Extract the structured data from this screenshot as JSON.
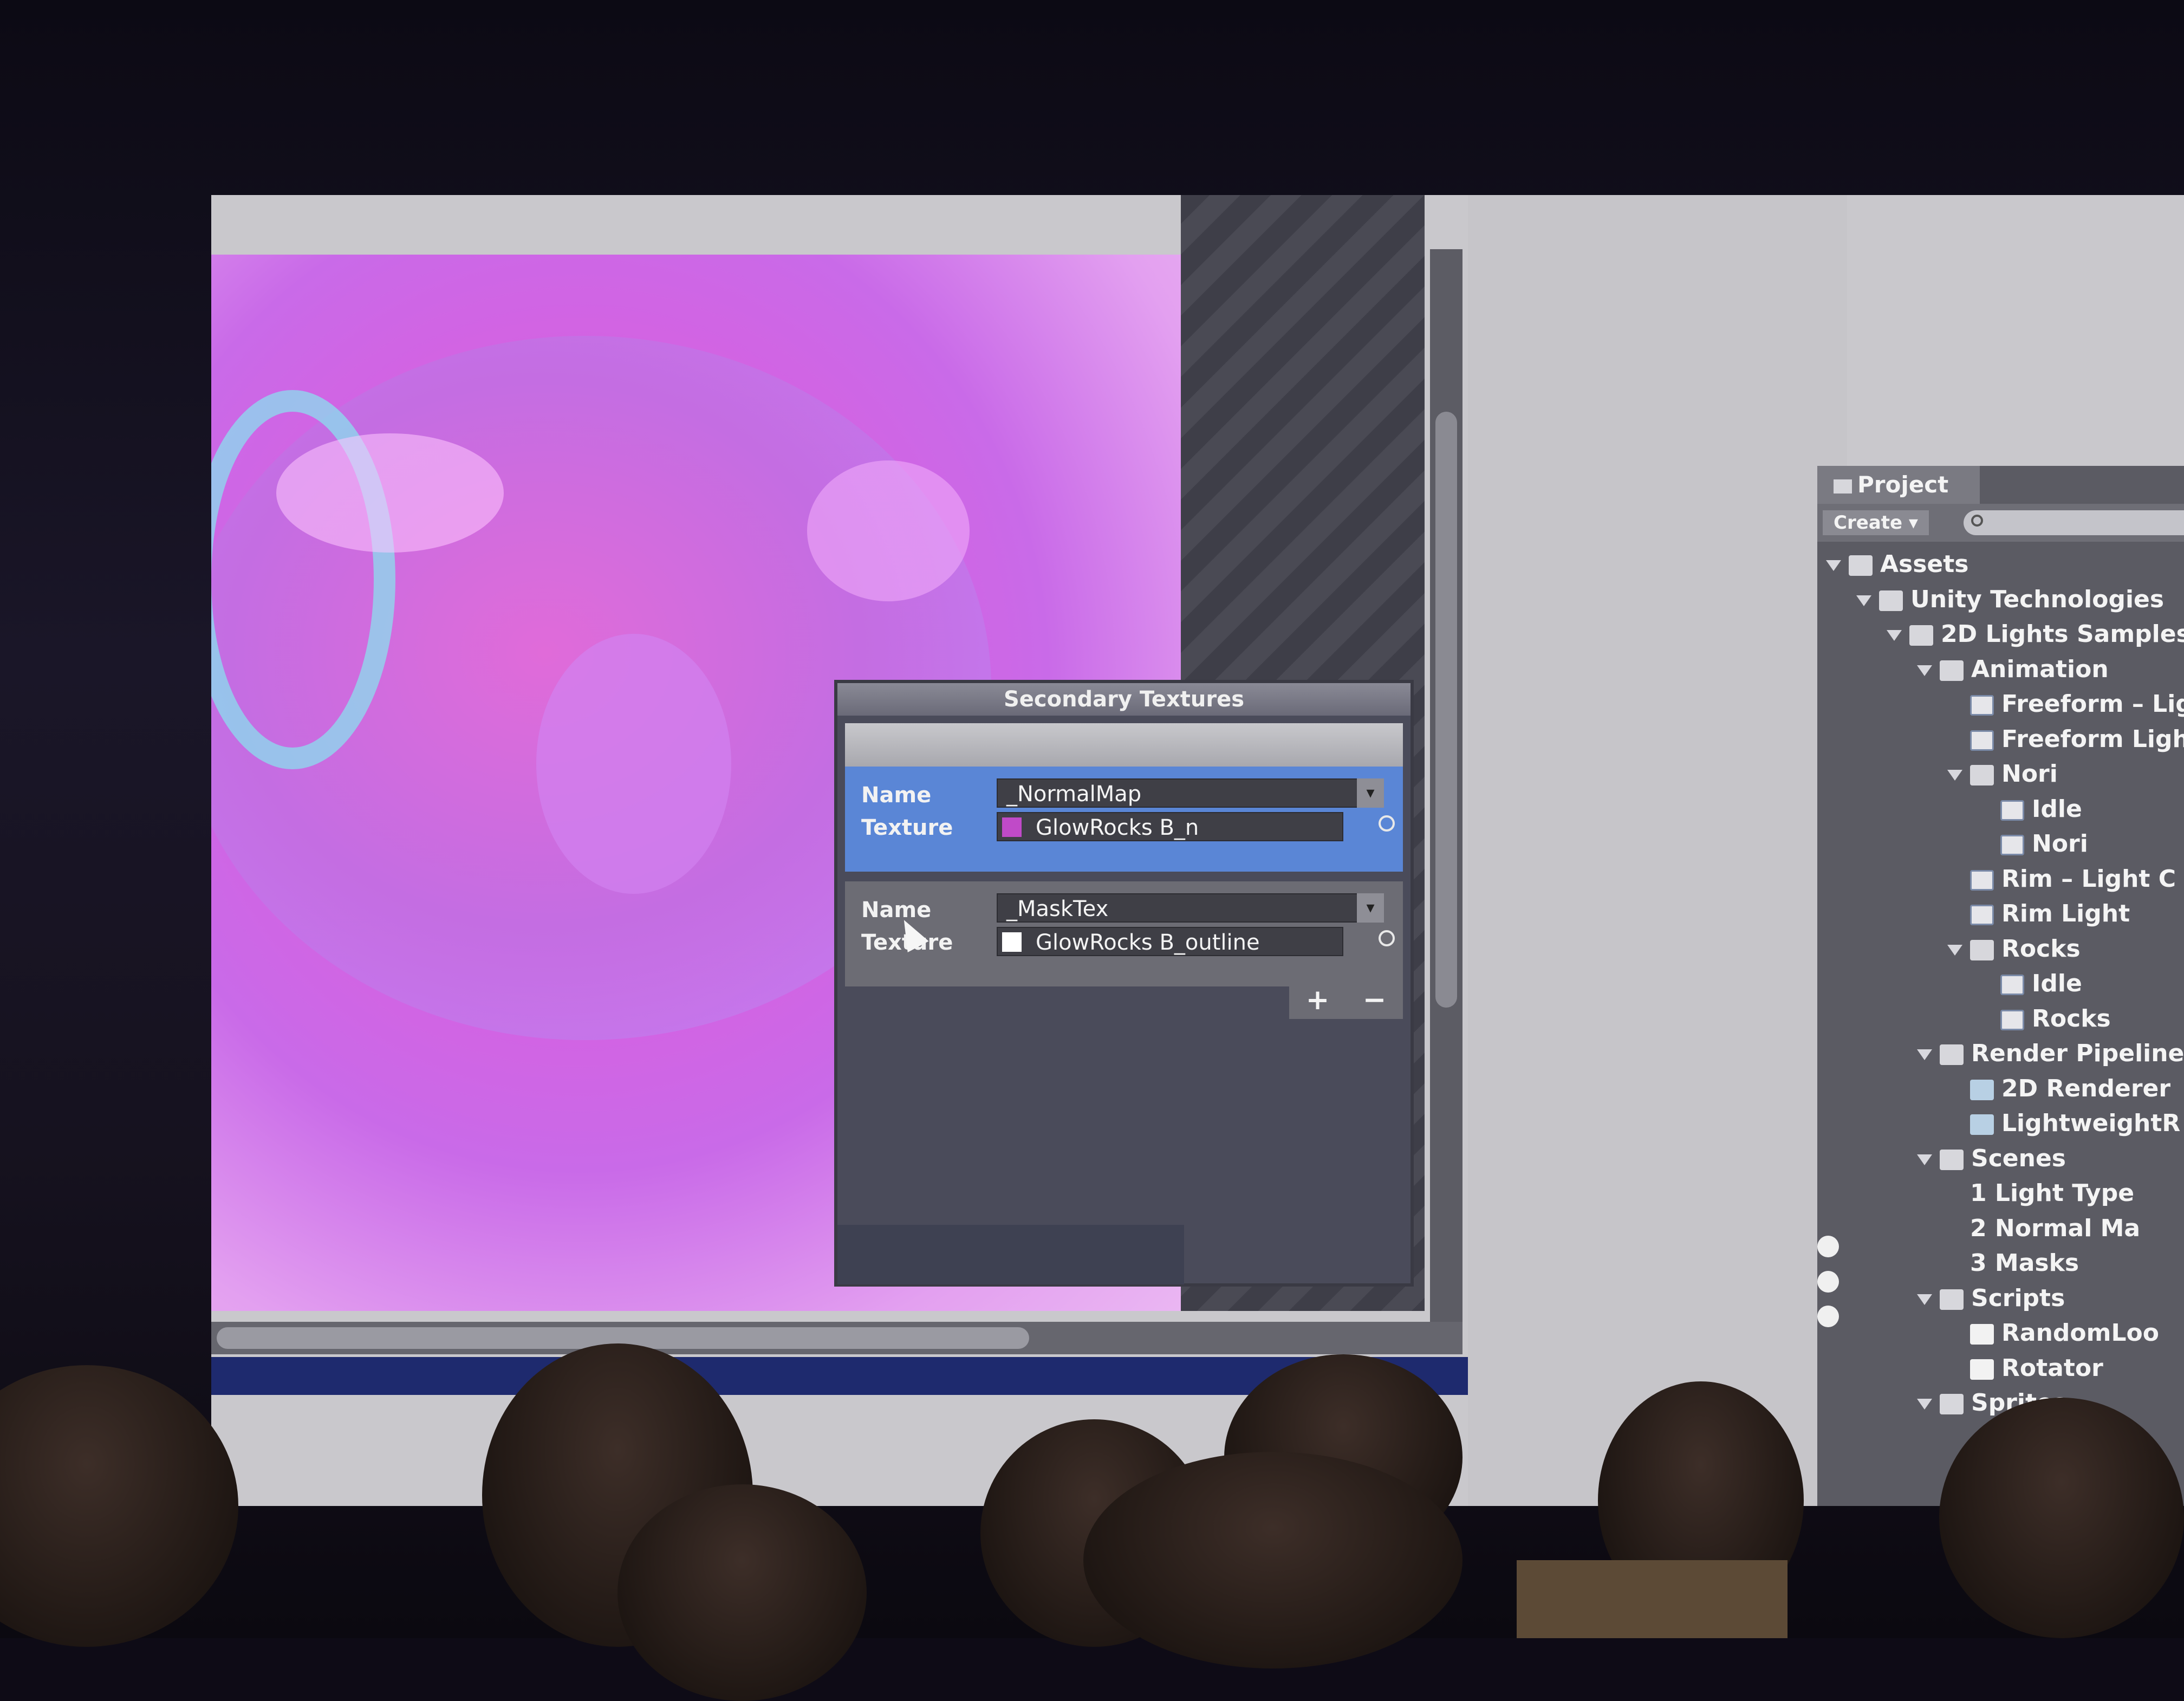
{
  "popup": {
    "title": "Secondary Textures",
    "labels": {
      "name": "Name",
      "texture": "Texture"
    },
    "entries": [
      {
        "name": "_NormalMap",
        "texture": "GlowRocks B_n",
        "swatch_color": "#c04ac8",
        "selected": true
      },
      {
        "name": "_MaskTex",
        "texture": "GlowRocks B_outline",
        "swatch_color": "#ffffff",
        "selected": false
      }
    ],
    "add_label": "+",
    "remove_label": "−"
  },
  "project": {
    "tab_label": "Project",
    "create_label": "Create ▾",
    "tree": [
      {
        "label": "Assets",
        "depth": 0,
        "icon": "folder-icon",
        "expanded": true
      },
      {
        "label": "Unity Technologies",
        "depth": 1,
        "icon": "folder-icon",
        "expanded": true
      },
      {
        "label": "2D Lights Samples",
        "depth": 2,
        "icon": "folder-icon",
        "expanded": true
      },
      {
        "label": "Animation",
        "depth": 3,
        "icon": "folder-icon",
        "expanded": true
      },
      {
        "label": "Freeform – Lig",
        "depth": 4,
        "icon": "animation-clip-icon"
      },
      {
        "label": "Freeform Ligh",
        "depth": 4,
        "icon": "animator-icon"
      },
      {
        "label": "Nori",
        "depth": 4,
        "icon": "folder-icon",
        "expanded": true
      },
      {
        "label": "Idle",
        "depth": 5,
        "icon": "animation-clip-icon"
      },
      {
        "label": "Nori",
        "depth": 5,
        "icon": "animator-icon"
      },
      {
        "label": "Rim – Light C",
        "depth": 4,
        "icon": "animation-clip-icon"
      },
      {
        "label": "Rim Light",
        "depth": 4,
        "icon": "animator-icon"
      },
      {
        "label": "Rocks",
        "depth": 4,
        "icon": "folder-icon",
        "expanded": true
      },
      {
        "label": "Idle",
        "depth": 5,
        "icon": "animation-clip-icon"
      },
      {
        "label": "Rocks",
        "depth": 5,
        "icon": "animator-icon"
      },
      {
        "label": "Render Pipeline",
        "depth": 3,
        "icon": "folder-icon",
        "expanded": true
      },
      {
        "label": "2D Renderer",
        "depth": 4,
        "icon": "asset-icon"
      },
      {
        "label": "LightweightR",
        "depth": 4,
        "icon": "asset-icon"
      },
      {
        "label": "Scenes",
        "depth": 3,
        "icon": "folder-icon",
        "expanded": true
      },
      {
        "label": "1 Light Type",
        "depth": 4,
        "icon": "scene-icon"
      },
      {
        "label": "2 Normal Ma",
        "depth": 4,
        "icon": "scene-icon"
      },
      {
        "label": "3 Masks",
        "depth": 4,
        "icon": "scene-icon"
      },
      {
        "label": "Scripts",
        "depth": 3,
        "icon": "folder-icon",
        "expanded": true
      },
      {
        "label": "RandomLoo",
        "depth": 4,
        "icon": "script-icon"
      },
      {
        "label": "Rotator",
        "depth": 4,
        "icon": "script-icon"
      },
      {
        "label": "Sprites",
        "depth": 3,
        "icon": "folder-icon",
        "expanded": true
      }
    ]
  },
  "colors": {
    "selection": "#5a86d6",
    "scene_magenta": "#d760e0",
    "editor_dark": "#4a4b5a"
  }
}
